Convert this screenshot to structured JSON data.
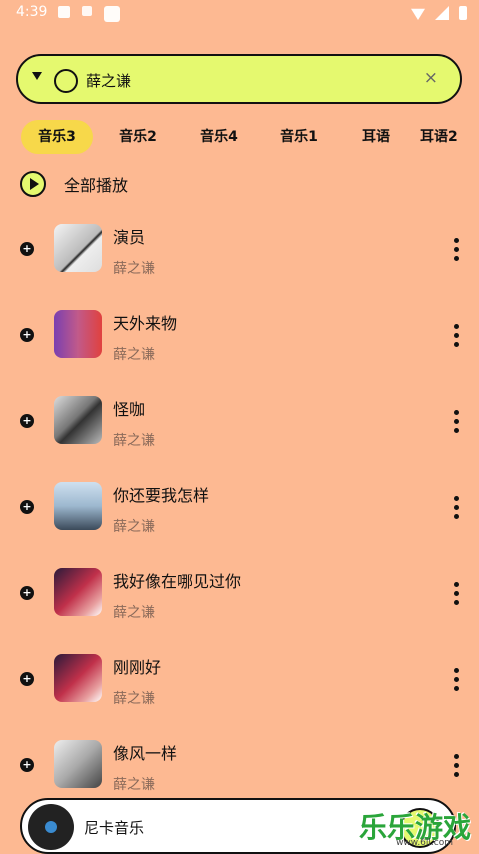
{
  "status_bar": {
    "time": "4:39"
  },
  "search": {
    "query": "薛之谦",
    "close_symbol": "×"
  },
  "tabs": [
    {
      "label": "音乐3",
      "active": true
    },
    {
      "label": "音乐2",
      "active": false
    },
    {
      "label": "音乐4",
      "active": false
    },
    {
      "label": "音乐1",
      "active": false
    },
    {
      "label": "耳语",
      "active": false
    },
    {
      "label": "耳语2",
      "active": false
    }
  ],
  "play_all": {
    "label": "全部播放"
  },
  "songs": [
    {
      "title": "演员",
      "artist": "薛之谦"
    },
    {
      "title": "天外来物",
      "artist": "薛之谦"
    },
    {
      "title": "怪咖",
      "artist": "薛之谦"
    },
    {
      "title": "你还要我怎样",
      "artist": "薛之谦"
    },
    {
      "title": "我好像在哪见过你",
      "artist": "薛之谦"
    },
    {
      "title": "刚刚好",
      "artist": "薛之谦"
    },
    {
      "title": "像风一样",
      "artist": "薛之谦"
    }
  ],
  "player": {
    "title": "尼卡音乐"
  },
  "watermark": {
    "text": "乐乐游戏",
    "url": "www.6ll.com"
  },
  "colors": {
    "background": "#FDB992",
    "accent": "#E5F96F",
    "tab_active": "#F7D84A"
  }
}
